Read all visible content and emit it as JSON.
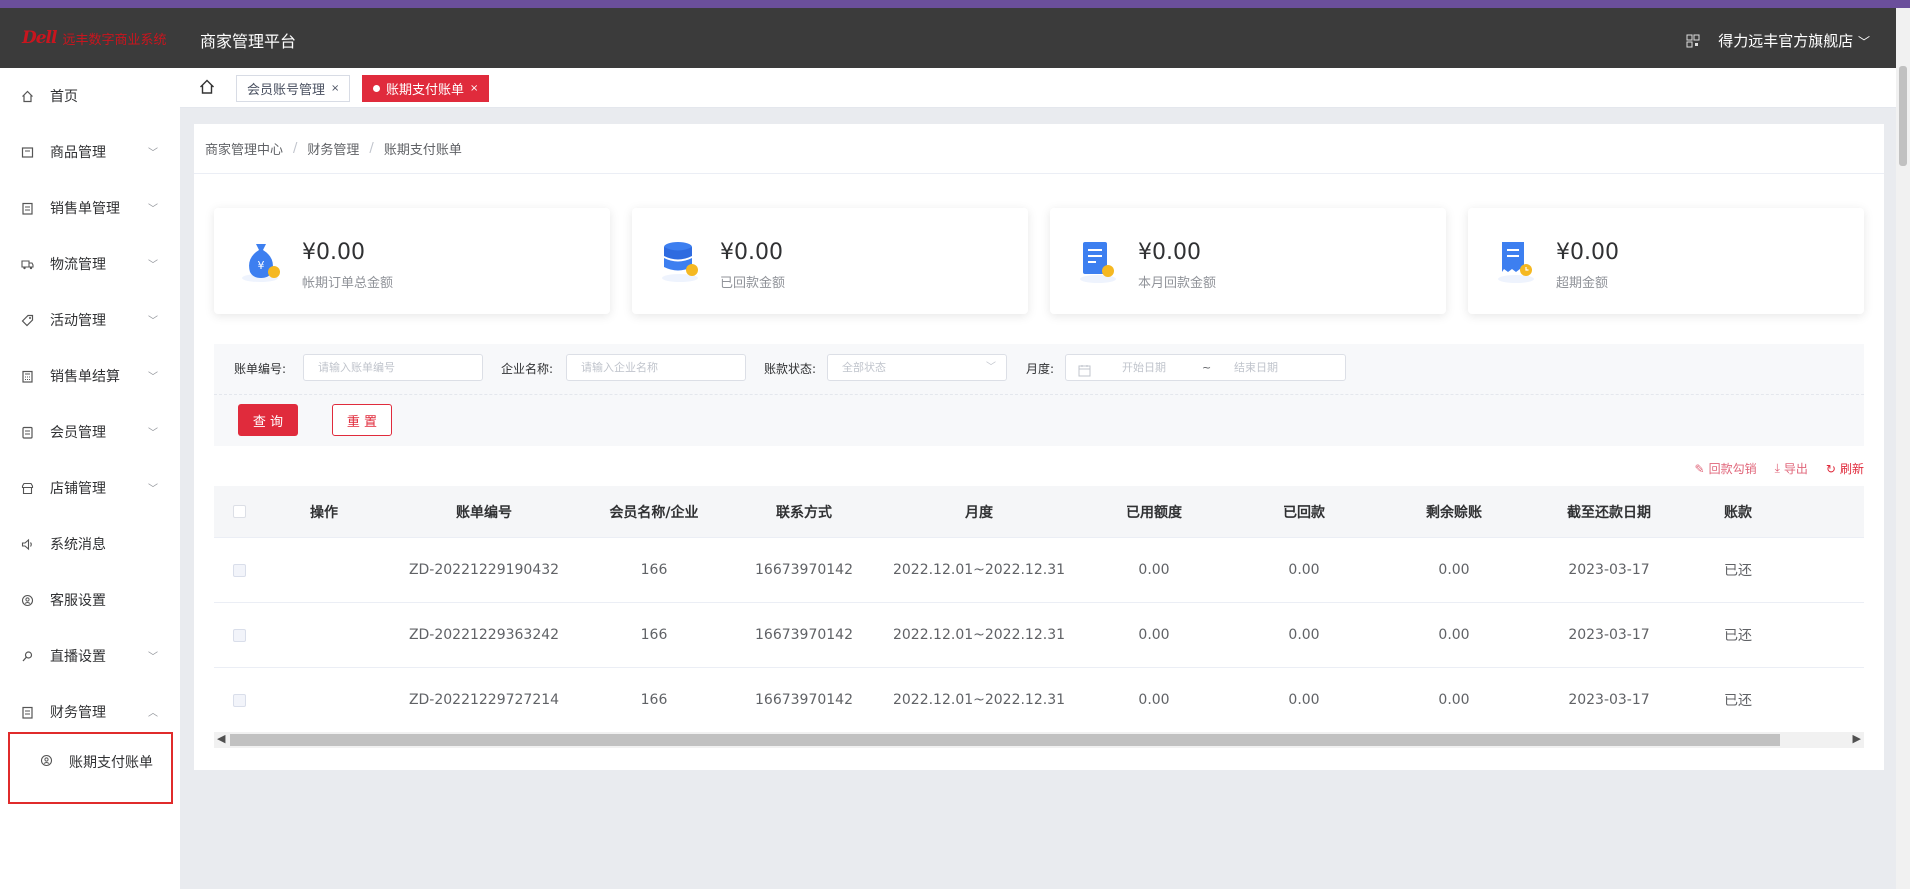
{
  "header": {
    "logo_mark": "Dell",
    "logo_text": "远丰数字商业系统",
    "platform_title": "商家管理平台",
    "store_name": "得力远丰官方旗舰店"
  },
  "sidebar": {
    "items": [
      {
        "label": "首页",
        "icon": "home-icon"
      },
      {
        "label": "商品管理",
        "icon": "box-icon"
      },
      {
        "label": "销售单管理",
        "icon": "clipboard-icon"
      },
      {
        "label": "物流管理",
        "icon": "truck-icon"
      },
      {
        "label": "活动管理",
        "icon": "tag-icon"
      },
      {
        "label": "销售单结算",
        "icon": "calculator-icon"
      },
      {
        "label": "会员管理",
        "icon": "member-icon"
      },
      {
        "label": "店铺管理",
        "icon": "store-icon"
      },
      {
        "label": "系统消息",
        "icon": "speaker-icon"
      },
      {
        "label": "客服设置",
        "icon": "support-icon"
      },
      {
        "label": "直播设置",
        "icon": "live-icon"
      },
      {
        "label": "财务管理",
        "icon": "finance-icon"
      }
    ],
    "submenu_label": "账期支付账单"
  },
  "tabs": [
    {
      "label": "会员账号管理",
      "active": false
    },
    {
      "label": "账期支付账单",
      "active": true
    }
  ],
  "breadcrumb": [
    "商家管理中心",
    "财务管理",
    "账期支付账单"
  ],
  "stats": [
    {
      "amount": "¥0.00",
      "label": "帐期订单总金额",
      "icon": "money-bag-icon"
    },
    {
      "amount": "¥0.00",
      "label": "已回款金额",
      "icon": "database-coin-icon"
    },
    {
      "amount": "¥0.00",
      "label": "本月回款金额",
      "icon": "document-coin-icon"
    },
    {
      "amount": "¥0.00",
      "label": "超期金额",
      "icon": "receipt-clock-icon"
    }
  ],
  "filter": {
    "bill_no_label": "账单编号:",
    "bill_no_placeholder": "请输入账单编号",
    "company_label": "企业名称:",
    "company_placeholder": "请输入企业名称",
    "status_label": "账款状态:",
    "status_value": "全部状态",
    "month_label": "月度:",
    "start_placeholder": "开始日期",
    "range_sep": "~",
    "end_placeholder": "结束日期",
    "query_button": "查 询",
    "reset_button": "重 置"
  },
  "toolbar": {
    "confirm_label": "回款勾销",
    "export_label": "导出",
    "refresh_label": "刷新"
  },
  "table": {
    "columns": [
      "操作",
      "账单编号",
      "会员名称/企业",
      "联系方式",
      "月度",
      "已用额度",
      "已回款",
      "剩余赊账",
      "截至还款日期",
      "账款"
    ],
    "rows": [
      {
        "bill_no": "ZD-20221229190432",
        "member": "166",
        "contact": "16673970142",
        "month": "2022.12.01~2022.12.31",
        "used": "0.00",
        "returned": "0.00",
        "remaining": "0.00",
        "due_date": "2023-03-17",
        "status": "已还"
      },
      {
        "bill_no": "ZD-20221229363242",
        "member": "166",
        "contact": "16673970142",
        "month": "2022.12.01~2022.12.31",
        "used": "0.00",
        "returned": "0.00",
        "remaining": "0.00",
        "due_date": "2023-03-17",
        "status": "已还"
      },
      {
        "bill_no": "ZD-20221229727214",
        "member": "166",
        "contact": "16673970142",
        "month": "2022.12.01~2022.12.31",
        "used": "0.00",
        "returned": "0.00",
        "remaining": "0.00",
        "due_date": "2023-03-17",
        "status": "已还"
      }
    ]
  },
  "colors": {
    "accent": "#e02b3c",
    "header_bg": "#3b3b3b",
    "icon_blue": "#3d7ff0",
    "icon_gold": "#f5b822"
  }
}
